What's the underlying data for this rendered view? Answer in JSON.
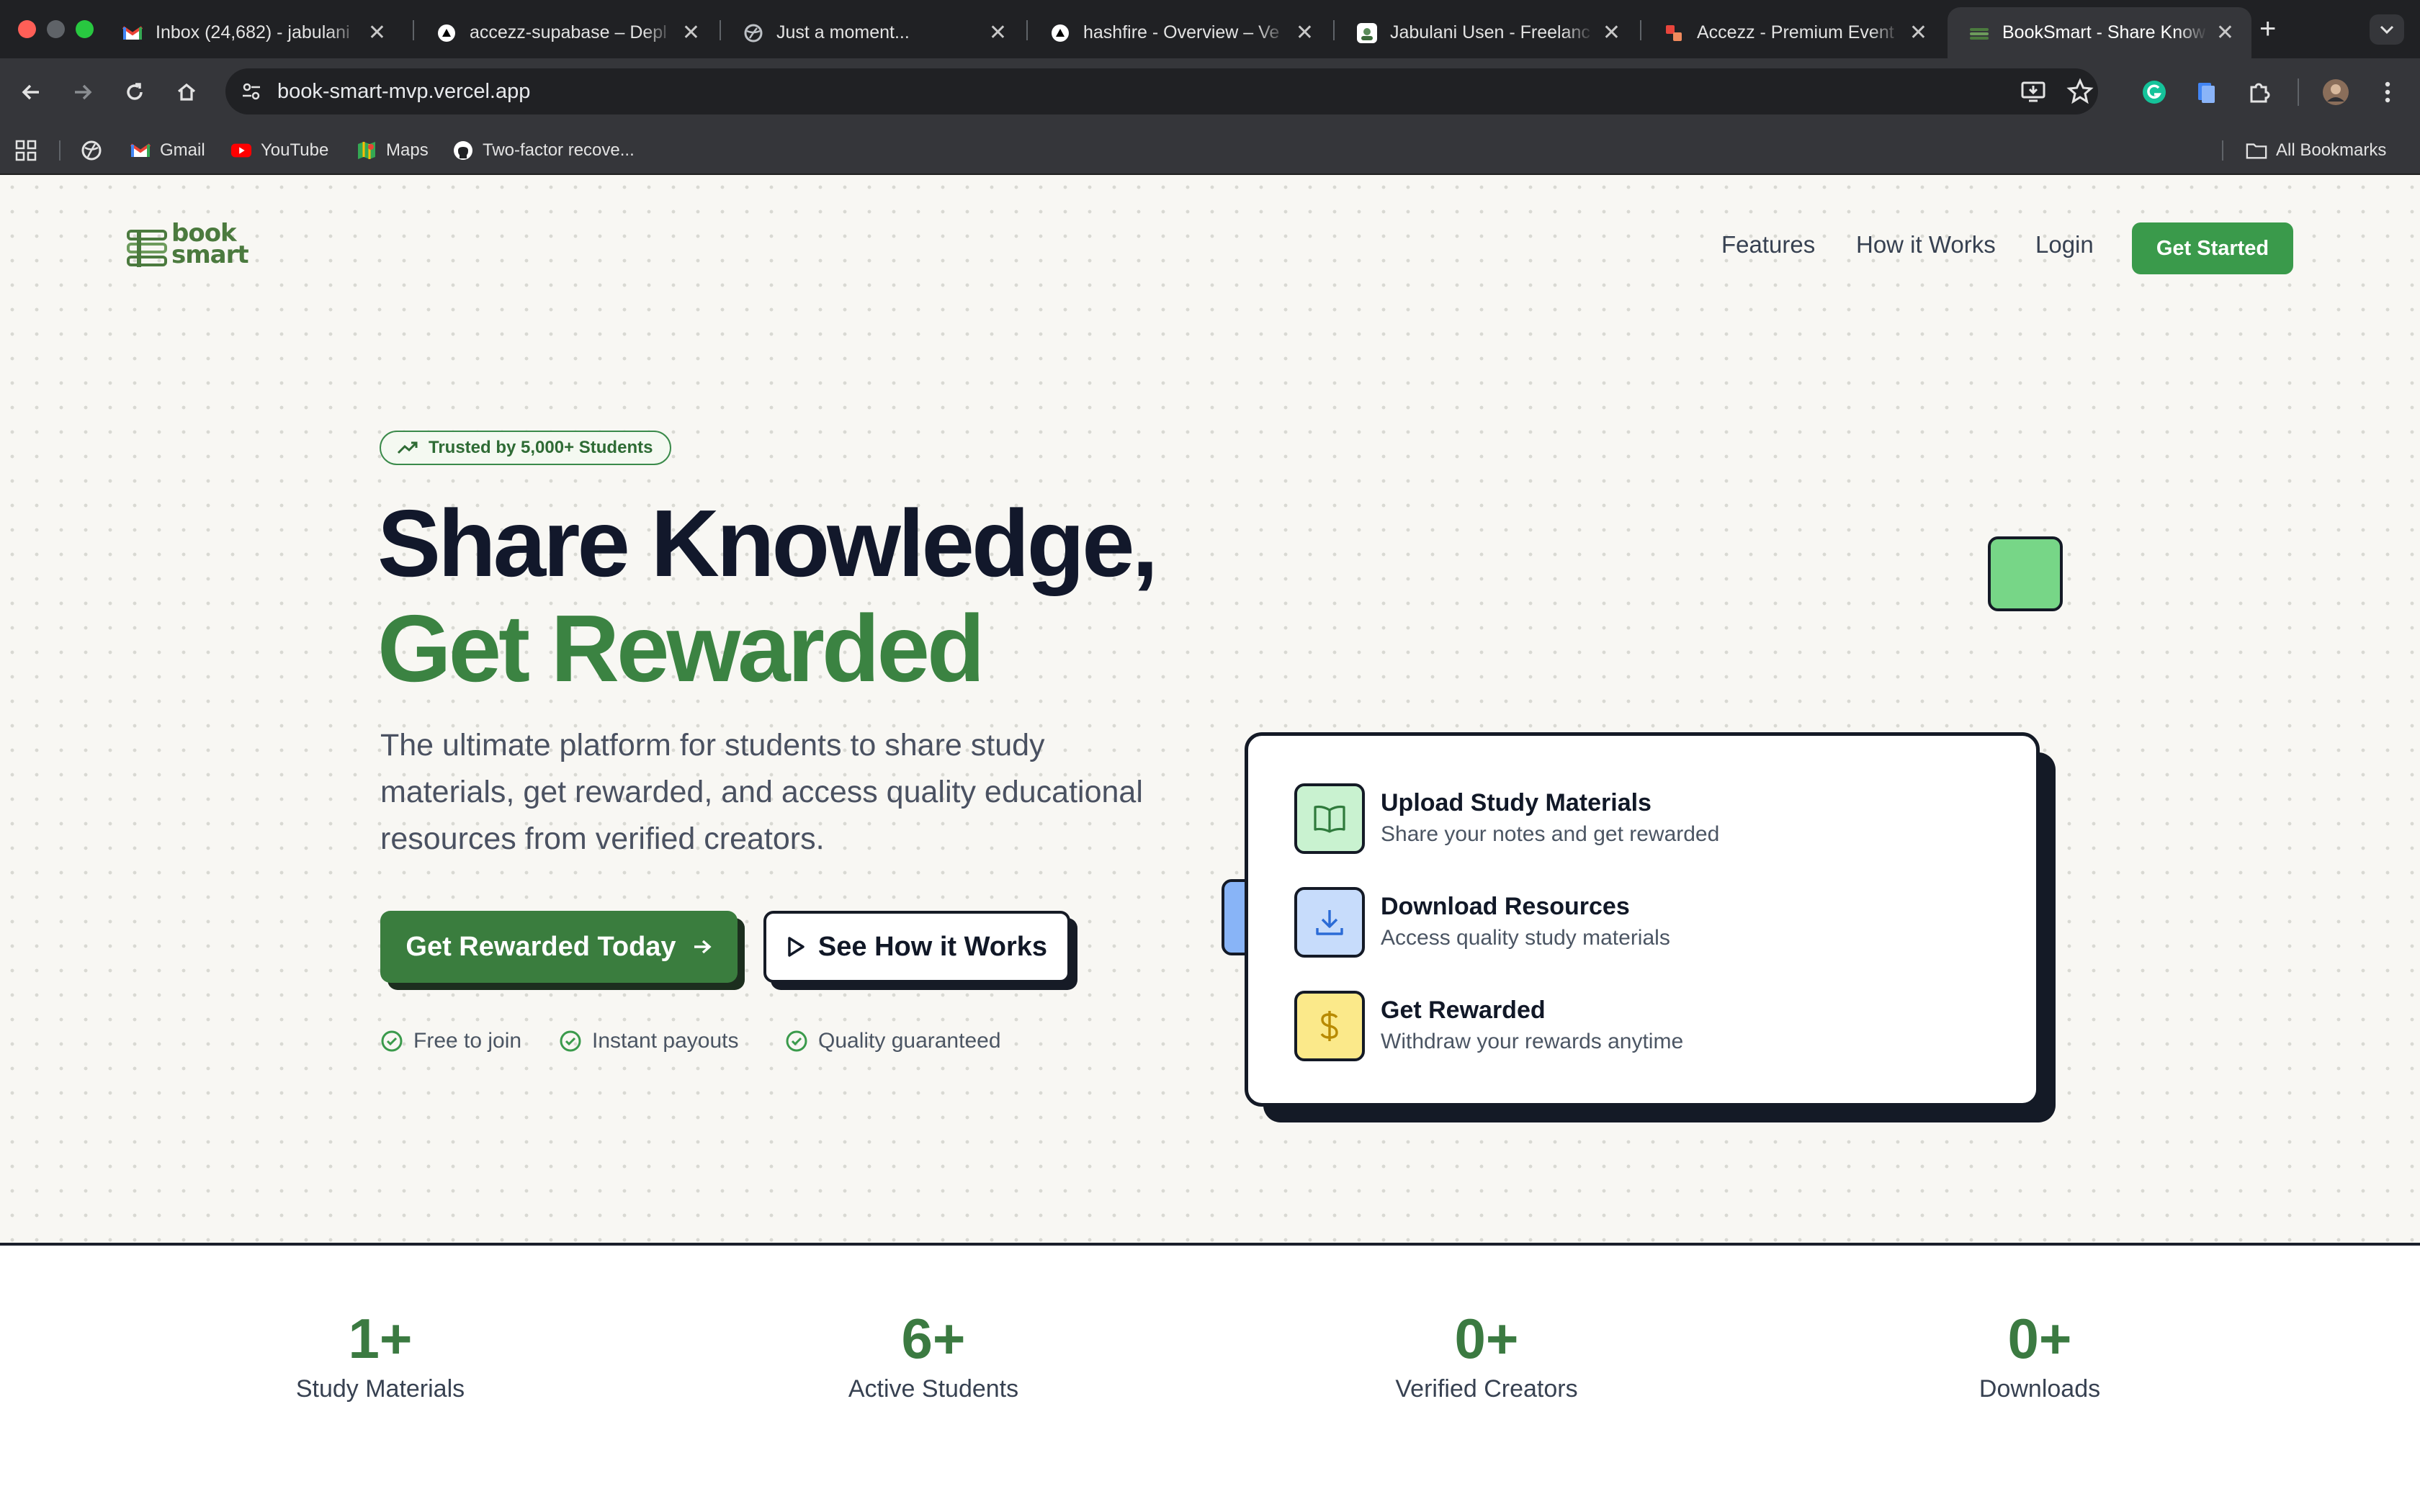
{
  "browser": {
    "tabs": [
      {
        "title": "Inbox (24,682) - jabulani",
        "favicon": "gmail-icon"
      },
      {
        "title": "accezz-supabase – Depl",
        "favicon": "vercel-icon"
      },
      {
        "title": "Just a moment...",
        "favicon": "globe-icon"
      },
      {
        "title": "hashfire - Overview – Ve",
        "favicon": "vercel-icon"
      },
      {
        "title": "Jabulani Usen - Freelanc",
        "favicon": "upwork-icon"
      },
      {
        "title": "Accezz - Premium Event",
        "favicon": "accezz-icon"
      },
      {
        "title": "BookSmart - Share Know",
        "favicon": "booksmart-icon",
        "active": true
      }
    ],
    "close_glyph": "✕",
    "new_tab_glyph": "+",
    "url": "book-smart-mvp.vercel.app",
    "bookmarks": [
      {
        "label": "Gmail",
        "icon": "gmail-icon"
      },
      {
        "label": "YouTube",
        "icon": "youtube-icon"
      },
      {
        "label": "Maps",
        "icon": "maps-icon"
      },
      {
        "label": "Two-factor recove...",
        "icon": "github-icon"
      }
    ],
    "all_bookmarks": "All Bookmarks"
  },
  "site": {
    "logo_line1": "book",
    "logo_line2": "smart",
    "nav": {
      "features": "Features",
      "how_it_works": "How it Works",
      "login": "Login",
      "cta": "Get Started"
    },
    "hero": {
      "badge": "Trusted by 5,000+ Students",
      "headline_line1": "Share Knowledge,",
      "headline_line2": "Get Rewarded",
      "lead": "The ultimate platform for students to share study materials, get rewarded, and access quality educational resources from verified creators.",
      "primary_button": "Get Rewarded Today",
      "secondary_button": "See How it Works",
      "perks": [
        "Free to join",
        "Instant payouts",
        "Quality guaranteed"
      ]
    },
    "card": {
      "features": [
        {
          "title": "Upload Study Materials",
          "desc": "Share your notes and get rewarded",
          "icon": "book-open-icon",
          "color": "#c9f2d0"
        },
        {
          "title": "Download Resources",
          "desc": "Access quality study materials",
          "icon": "download-icon",
          "color": "#c7dcfb"
        },
        {
          "title": "Get Rewarded",
          "desc": "Withdraw your rewards anytime",
          "icon": "dollar-icon",
          "color": "#fbe98a"
        }
      ]
    },
    "stats": [
      {
        "value": "1+",
        "label": "Study Materials"
      },
      {
        "value": "6+",
        "label": "Active Students"
      },
      {
        "value": "0+",
        "label": "Verified Creators"
      },
      {
        "value": "0+",
        "label": "Downloads"
      }
    ]
  },
  "colors": {
    "brand_green": "#3a9a4b",
    "headline_green": "#3b8342",
    "dark": "#12182b"
  }
}
